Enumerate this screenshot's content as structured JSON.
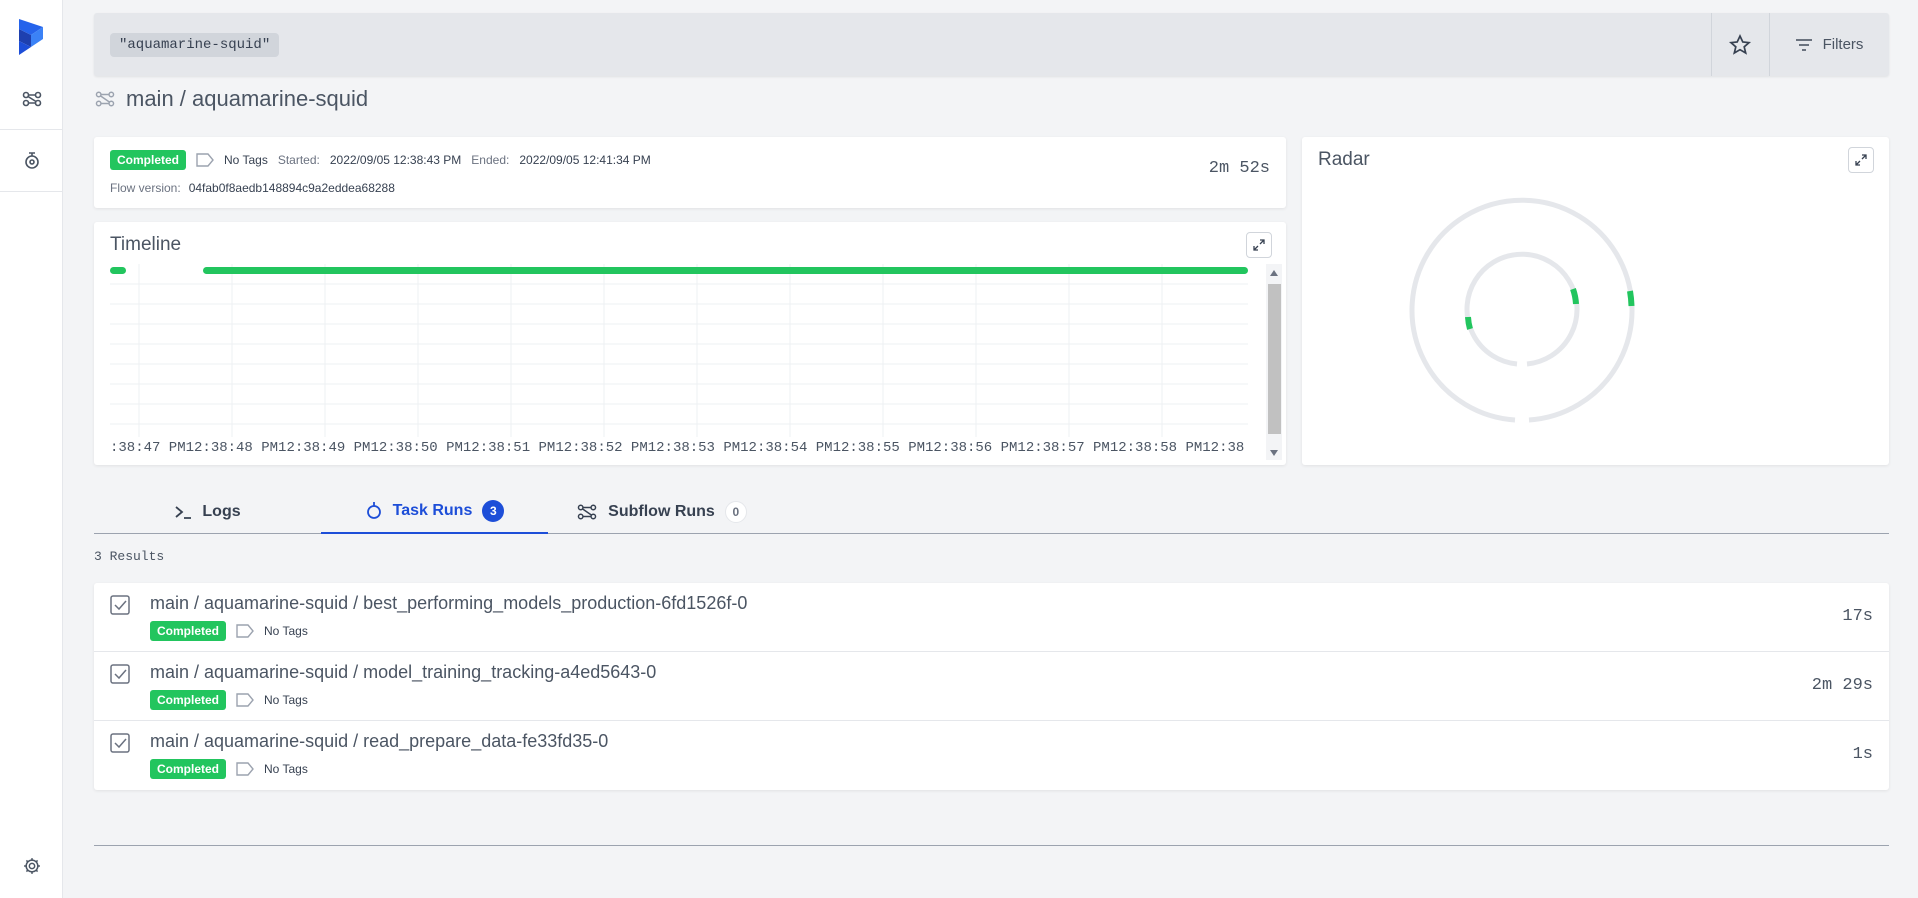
{
  "search": {
    "chip": "\"aquamarine-squid\"",
    "filters_label": "Filters"
  },
  "page": {
    "title": "main / aquamarine-squid"
  },
  "flow_run": {
    "state": "Completed",
    "tags": "No Tags",
    "started_label": "Started:",
    "started": "2022/09/05 12:38:43 PM",
    "ended_label": "Ended:",
    "ended": "2022/09/05 12:41:34 PM",
    "version_label": "Flow version:",
    "version": "04fab0f8aedb148894c9a2eddea68288",
    "duration": "2m 52s"
  },
  "timeline": {
    "title": "Timeline",
    "ticks": [
      ":38:47 PM",
      "12:38:48 PM",
      "12:38:49 PM",
      "12:38:50 PM",
      "12:38:51 PM",
      "12:38:52 PM",
      "12:38:53 PM",
      "12:38:54 PM",
      "12:38:55 PM",
      "12:38:56 PM",
      "12:38:57 PM",
      "12:38:58 PM",
      "12:38"
    ]
  },
  "radar": {
    "title": "Radar"
  },
  "tabs": [
    {
      "label": "Logs"
    },
    {
      "label": "Task Runs",
      "count": "3"
    },
    {
      "label": "Subflow Runs",
      "count": "0"
    }
  ],
  "results_label": "3 Results",
  "task_runs": [
    {
      "name": "main / aquamarine-squid / best_performing_models_production-6fd1526f-0",
      "state": "Completed",
      "tags": "No Tags",
      "duration": "17s"
    },
    {
      "name": "main / aquamarine-squid / model_training_tracking-a4ed5643-0",
      "state": "Completed",
      "tags": "No Tags",
      "duration": "2m 29s"
    },
    {
      "name": "main / aquamarine-squid / read_prepare_data-fe33fd35-0",
      "state": "Completed",
      "tags": "No Tags",
      "duration": "1s"
    }
  ],
  "colors": {
    "accent": "#1d4ed8",
    "success": "#22c55e"
  }
}
